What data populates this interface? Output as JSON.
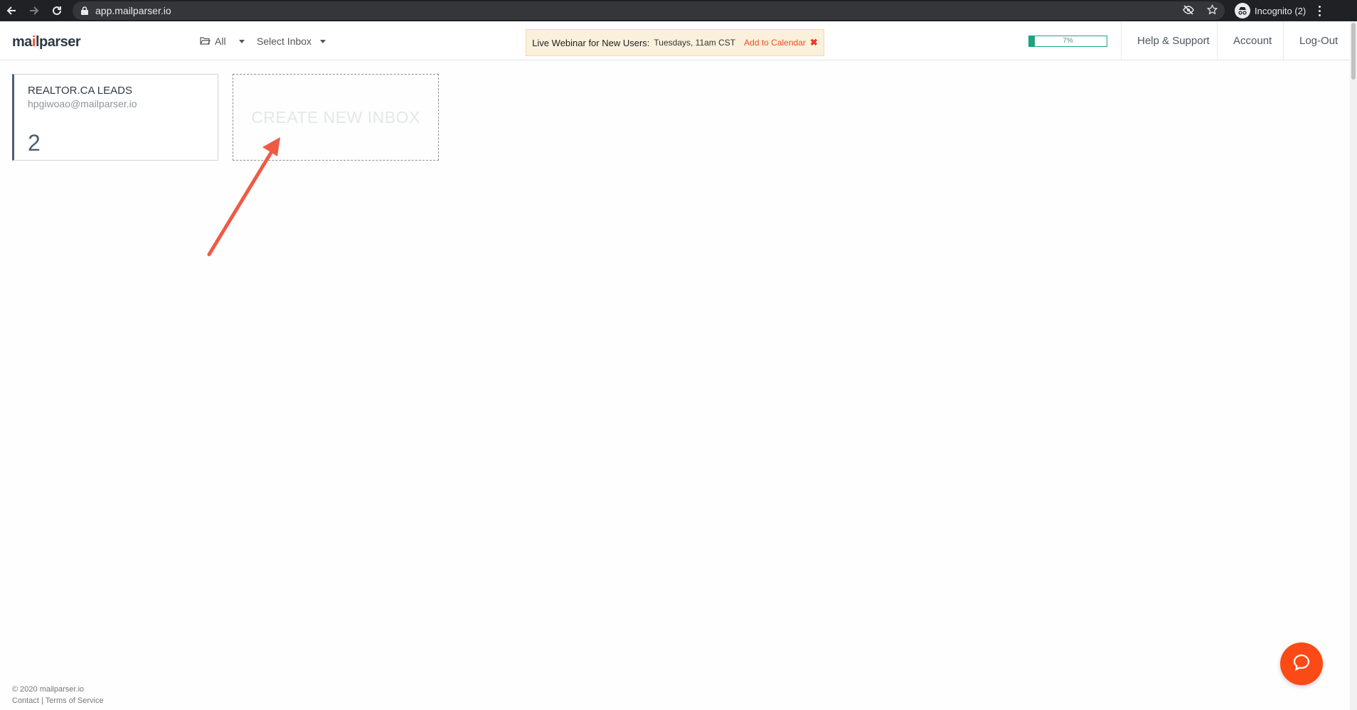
{
  "browser": {
    "url": "app.mailparser.io",
    "profile_label": "Incognito (2)"
  },
  "header": {
    "logo_prefix": "ma",
    "logo_i": "i",
    "logo_suffix": "lparser",
    "all_label": "All",
    "select_inbox_label": "Select Inbox",
    "webinar": {
      "title": "Live Webinar for New Users:",
      "when": "Tuesdays, 11am CST",
      "add_calendar": "Add to Calendar"
    },
    "usage_percent_label": "7%",
    "usage_fraction": 0.07,
    "nav": {
      "help": "Help & Support",
      "account": "Account",
      "logout": "Log-Out"
    }
  },
  "inbox": {
    "title": "REALTOR.CA LEADS",
    "email": "hpgiwoao@mailparser.io",
    "count": "2"
  },
  "create_inbox_label": "CREATE NEW INBOX",
  "footer": {
    "copyright": "© 2020 mailparser.io",
    "contact": "Contact",
    "separator": " | ",
    "terms": "Terms of Service"
  },
  "colors": {
    "accent": "#f04e23",
    "usage_green": "#1ca37f",
    "arrow": "#ef5a45",
    "chat": "#fb4a16"
  }
}
